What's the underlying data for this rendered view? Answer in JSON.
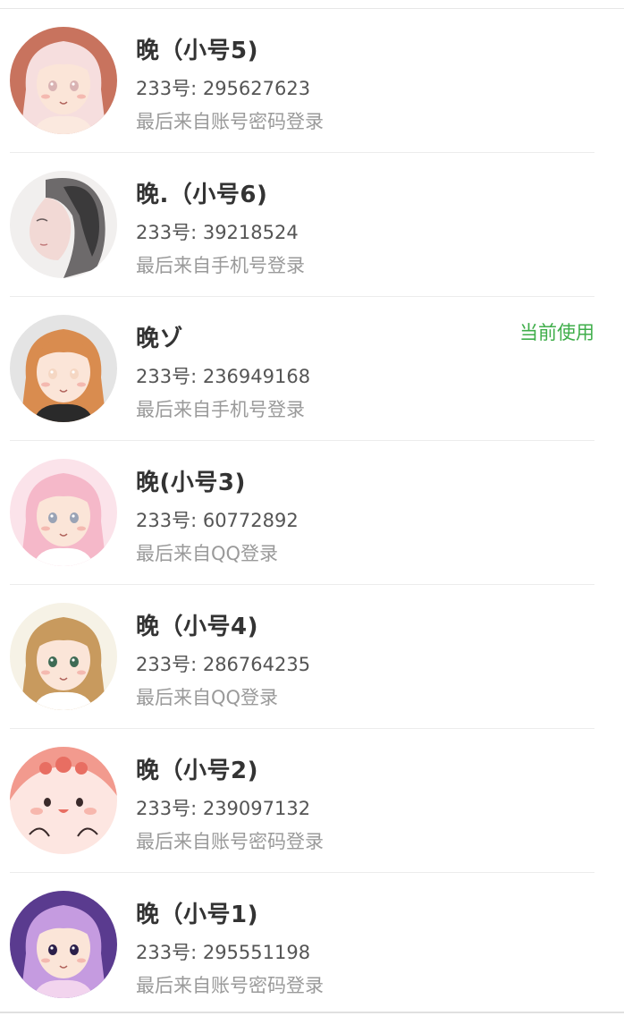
{
  "accounts": [
    {
      "nickname": "晚（小号5)",
      "id_line": "233号: 295627623",
      "login_source": "最后来自账号密码登录",
      "avatar_icon": "anime-girl-avatar",
      "avatar_colors": [
        "#c8735e",
        "#f6dede",
        "#fbe9df",
        "#d9b3b3"
      ]
    },
    {
      "nickname": "晚.（小号6)",
      "id_line": "233号: 39218524",
      "login_source": "最后来自手机号登录",
      "avatar_icon": "sketch-girl-avatar",
      "avatar_colors": [
        "#f1efee",
        "#6d6a6b",
        "#3b3a3b",
        "#f2d9d5"
      ]
    },
    {
      "nickname": "晚ゾ",
      "id_line": "233号: 236949168",
      "login_source": "最后来自手机号登录",
      "avatar_icon": "anime-girl-avatar",
      "avatar_colors": [
        "#e4e4e4",
        "#d98c4f",
        "#2a2a2a",
        "#f5d7c3"
      ],
      "current_label": "当前使用"
    },
    {
      "nickname": "晚(小号3)",
      "id_line": "233号: 60772892",
      "login_source": "最后来自QQ登录",
      "avatar_icon": "anime-girl-avatar",
      "avatar_colors": [
        "#fbe3ea",
        "#f5b8c9",
        "#ffffff",
        "#9aa3b5"
      ]
    },
    {
      "nickname": "晚（小号4)",
      "id_line": "233号: 286764235",
      "login_source": "最后来自QQ登录",
      "avatar_icon": "anime-girl-avatar",
      "avatar_colors": [
        "#f6f2e6",
        "#c89a5e",
        "#ffffff",
        "#3f6b55"
      ]
    },
    {
      "nickname": "晚（小号2)",
      "id_line": "233号: 239097132",
      "login_source": "最后来自账号密码登录",
      "avatar_icon": "cute-blob-avatar",
      "avatar_colors": [
        "#f29a8e",
        "#fde6e1",
        "#e86e62",
        "#3a2a2a"
      ]
    },
    {
      "nickname": "晚（小号1)",
      "id_line": "233号: 295551198",
      "login_source": "最后来自账号密码登录",
      "avatar_icon": "anime-girl-avatar",
      "avatar_colors": [
        "#5a3b8f",
        "#c59be0",
        "#f2d4ee",
        "#2b1f4a"
      ]
    }
  ]
}
